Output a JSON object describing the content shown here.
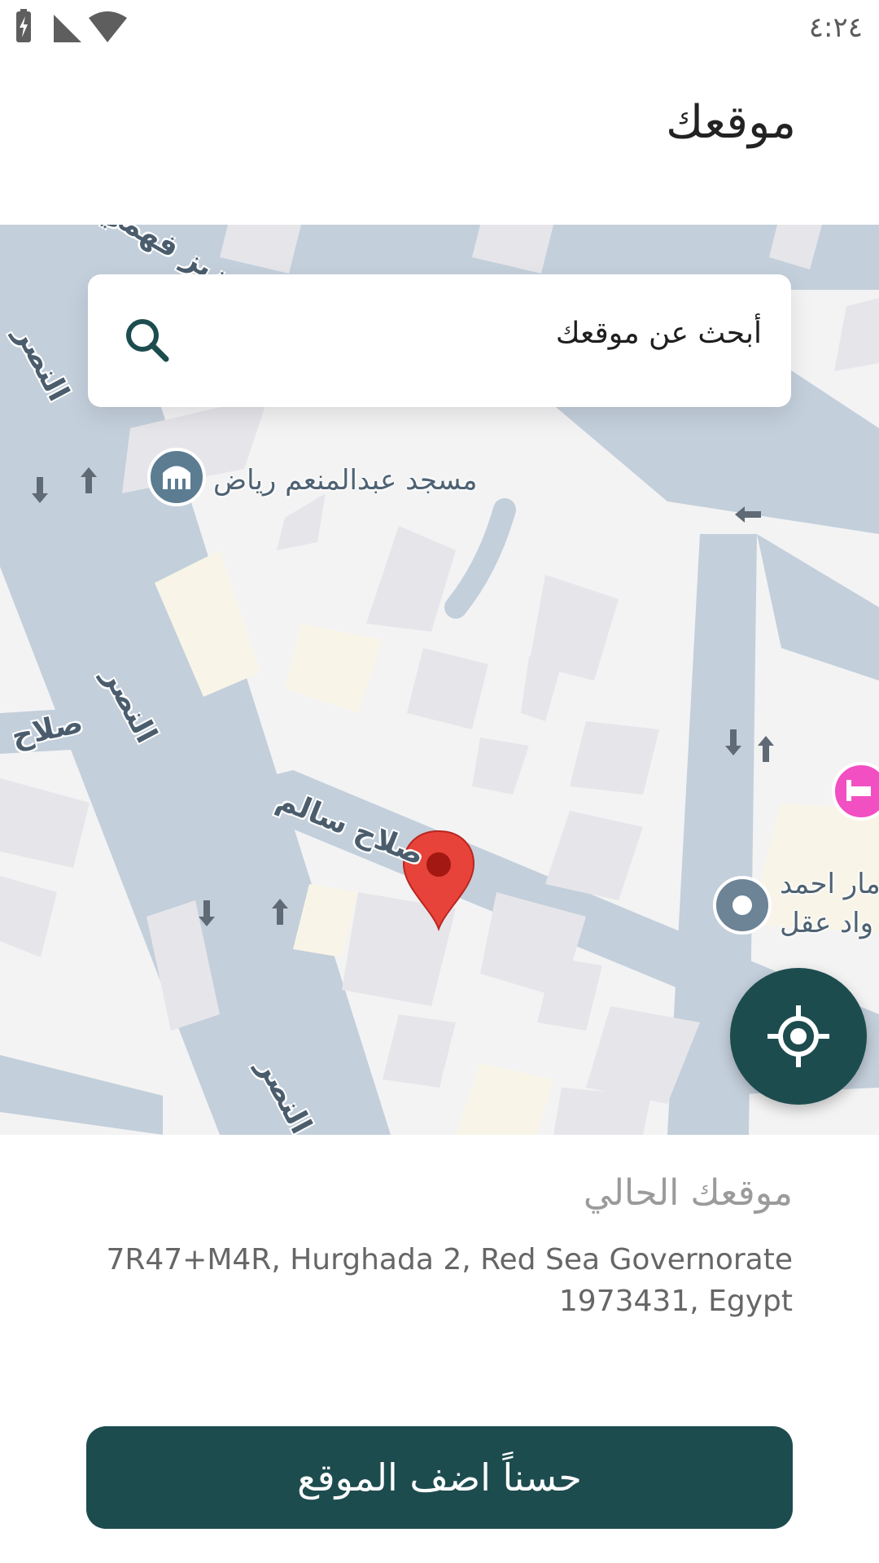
{
  "status_bar": {
    "time": "٤:٢٤",
    "icons": [
      "battery-charging-icon",
      "cell-signal-icon",
      "wifi-icon"
    ]
  },
  "header": {
    "title": "موقعك"
  },
  "search": {
    "placeholder": "أبحث عن موقعك",
    "icon": "search-icon"
  },
  "map": {
    "poi_mosque": "مسجد عبدالمنعم رياض",
    "poi_building_line1": "مار احمد",
    "poi_building_line2": "واد عقل",
    "street_1": "النصر",
    "street_2": "صلاح",
    "street_3": "صلاح سالم",
    "street_4": "النصر",
    "street_5": "النصر",
    "street_top": "عزيز فهمي",
    "pin_color": "#e8433a",
    "accent_color": "#1d4c4f",
    "hotel_color": "#f24fc2",
    "locate_icon": "my-location-icon"
  },
  "sheet": {
    "title": "موقعك الحالي",
    "address_line1": "7R47+M4R, Hurghada 2, Red Sea Governorate",
    "address_line2": "1973431, Egypt"
  },
  "actions": {
    "confirm": "حسناً اضف الموقع"
  }
}
